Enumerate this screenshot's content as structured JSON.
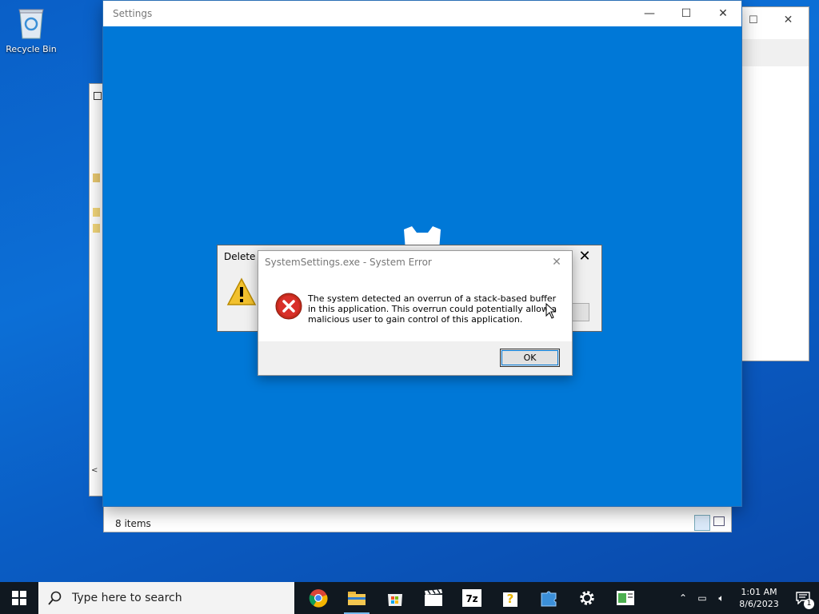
{
  "desktop": {
    "recycle_bin_label": "Recycle Bin"
  },
  "explorer": {
    "status_items": "8 items"
  },
  "settings_window": {
    "title": "Settings",
    "minimize": "—",
    "maximize": "☐",
    "close": "✕"
  },
  "delete_dialog": {
    "title_partial": "Delete M",
    "close": "✕"
  },
  "error_dialog": {
    "title": "SystemSettings.exe - System Error",
    "message": "The system detected an overrun of a stack-based buffer in this application. This overrun could potentially allow a malicious user to gain control of this application.",
    "ok_label": "OK",
    "close": "✕"
  },
  "taskbar": {
    "search_placeholder": "Type here to search",
    "apps": [
      "chrome-icon",
      "file-explorer-icon",
      "store-icon",
      "video-editor-icon",
      "7zip-icon",
      "help-icon",
      "puzzle-icon",
      "settings-icon",
      "notepad-icon"
    ],
    "clock_time": "1:01 AM",
    "clock_date": "8/6/2023",
    "notification_count": "1"
  },
  "colors": {
    "settings_blue": "#0078d7",
    "taskbar": "#101820",
    "error_red": "#c42b1c",
    "warning_yellow": "#f2c12e"
  }
}
